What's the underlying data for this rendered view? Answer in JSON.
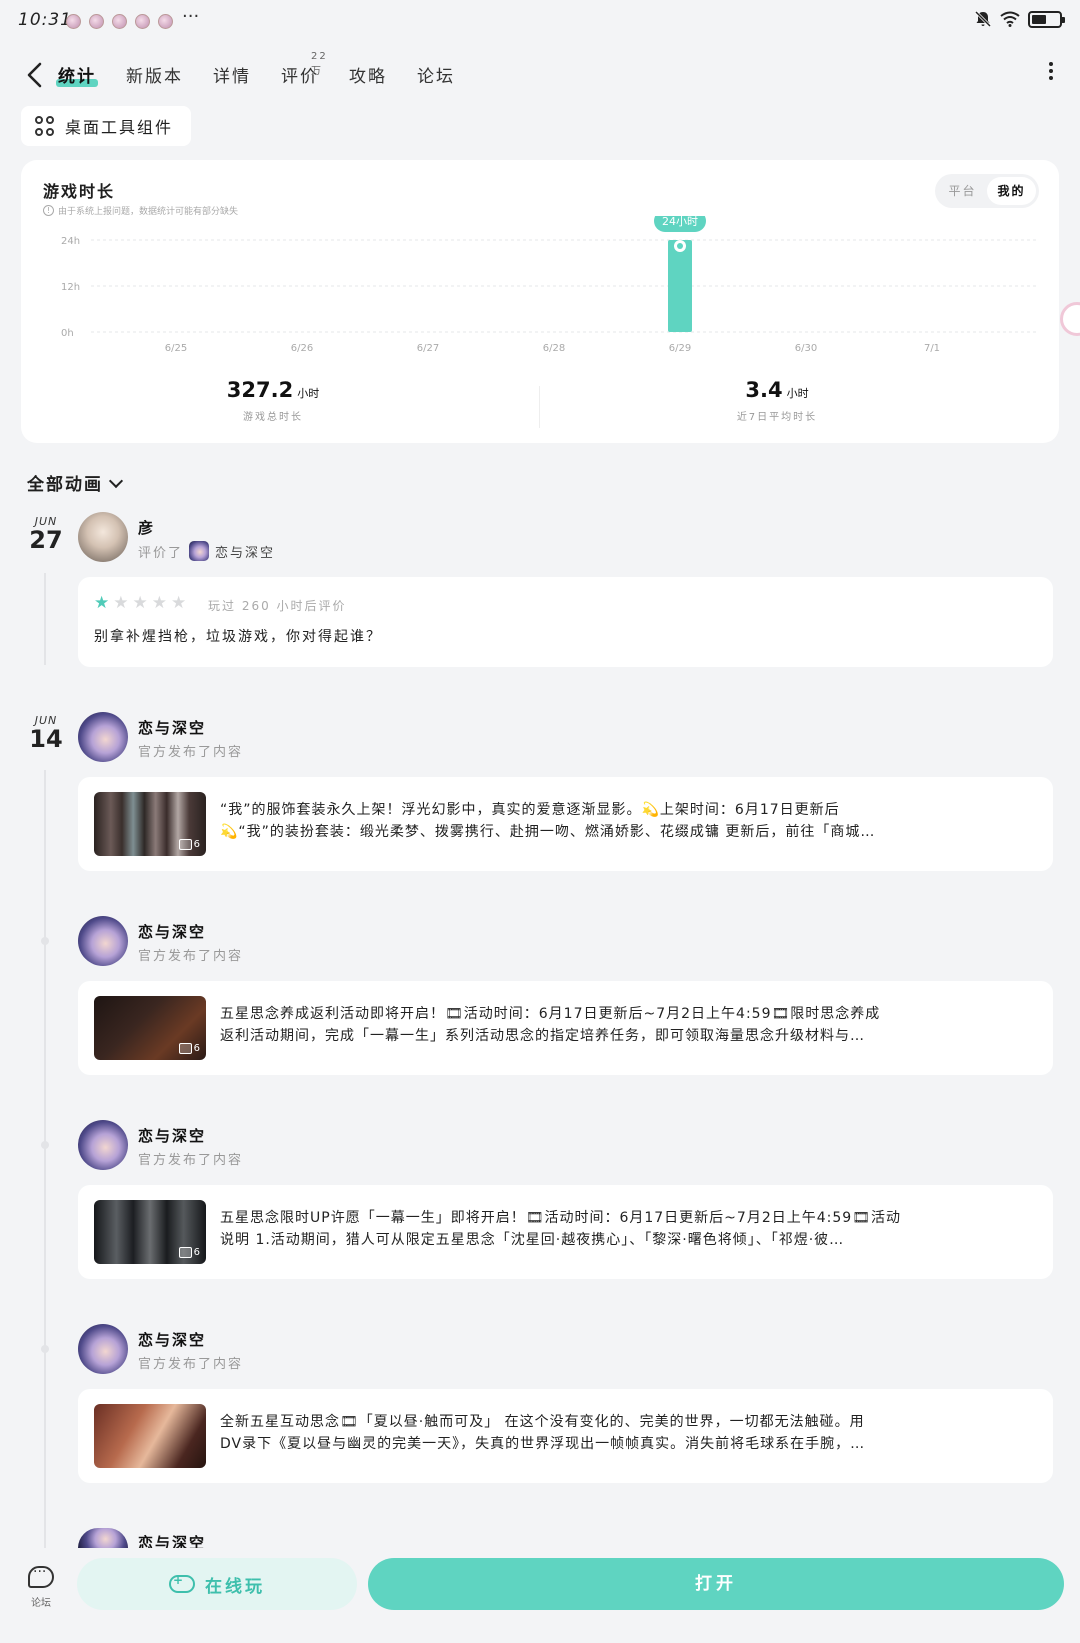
{
  "status_bar": {
    "time": "10:31",
    "more": "···"
  },
  "nav": {
    "tabs": [
      {
        "label": "统计",
        "active": true
      },
      {
        "label": "新版本",
        "active": false
      },
      {
        "label": "详情",
        "active": false
      },
      {
        "label": "评价",
        "active": false,
        "badge": "22万"
      },
      {
        "label": "攻略",
        "active": false
      },
      {
        "label": "论坛",
        "active": false
      }
    ]
  },
  "widget_button": {
    "label": "桌面工具组件"
  },
  "stats": {
    "title": "游戏时长",
    "note": "由于系统上报问题，数据统计可能有部分缺失",
    "toggle": {
      "platform": "平台",
      "mine": "我的",
      "selected": "mine"
    },
    "accent": "#5fd4c1",
    "total": {
      "value": "327.2",
      "unit": "小时",
      "label": "游戏总时长"
    },
    "avg": {
      "value": "3.4",
      "unit": "小时",
      "label": "近7日平均时长"
    }
  },
  "chart_data": {
    "type": "bar",
    "categories": [
      "6/25",
      "6/26",
      "6/27",
      "6/28",
      "6/29",
      "6/30",
      "7/1"
    ],
    "values": [
      0,
      0,
      0,
      0,
      24,
      0,
      0
    ],
    "ylim": [
      0,
      24
    ],
    "yticks": [
      "24h",
      "12h",
      "0h"
    ],
    "ytick_values": [
      24,
      12,
      0
    ],
    "grid": true,
    "highlight_label": "24小时",
    "highlight_index": 4
  },
  "feed": {
    "filter_label": "全部动画",
    "review": {
      "date_month": "JUN",
      "date_day": "27",
      "author": "彦",
      "action": "评价了",
      "game_name": "恋与深空",
      "stars": 1,
      "max_stars": 5,
      "meta": "玩过 260 小时后评价",
      "text": "别拿补煋挡枪，垃圾游戏，你对得起谁？"
    },
    "date_group2": {
      "month": "JUN",
      "day": "14"
    },
    "posts": [
      {
        "author": "恋与深空",
        "action": "官方发布了内容",
        "image_count": "6",
        "line1": "“我”的服饰套装永久上架！浮光幻影中，真实的爱意逐渐显影。💫上架时间：6月17日更新后",
        "line2": "💫“我”的装扮套装：缎光柔梦、拨雾携行、赴拥一吻、燃涌娇影、花缀成镛 更新后，前往「商城…"
      },
      {
        "author": "恋与深空",
        "action": "官方发布了内容",
        "image_count": "6",
        "line1": "五星思念养成返利活动即将开启！🎞活动时间：6月17日更新后~7月2日上午4:59🎞限时思念养成",
        "line2": "返利活动期间，完成「一幕一生」系列活动思念的指定培养任务，即可领取海量思念升级材料与…"
      },
      {
        "author": "恋与深空",
        "action": "官方发布了内容",
        "image_count": "6",
        "line1": "五星思念限时UP许愿「一幕一生」即将开启！🎞活动时间：6月17日更新后~7月2日上午4:59🎞活动",
        "line2": "说明 1.活动期间，猎人可从限定五星思念「沈星回·越夜携心」、「黎深·曙色将倾」、「祁煜·彼…"
      },
      {
        "author": "恋与深空",
        "action": "官方发布了内容",
        "image_count": "",
        "line1": "全新五星互动思念🎞「夏以昼·触而可及」 在这个没有变化的、完美的世界，一切都无法触碰。用",
        "line2": "DV录下《夏以昼与幽灵的完美一天》，失真的世界浮现出一帧帧真实。消失前将毛球系在手腕，…"
      }
    ],
    "peek_author": "恋与深空"
  },
  "bottom_bar": {
    "forum_label": "论坛",
    "online_label": "在线玩",
    "open_label": "打开"
  }
}
